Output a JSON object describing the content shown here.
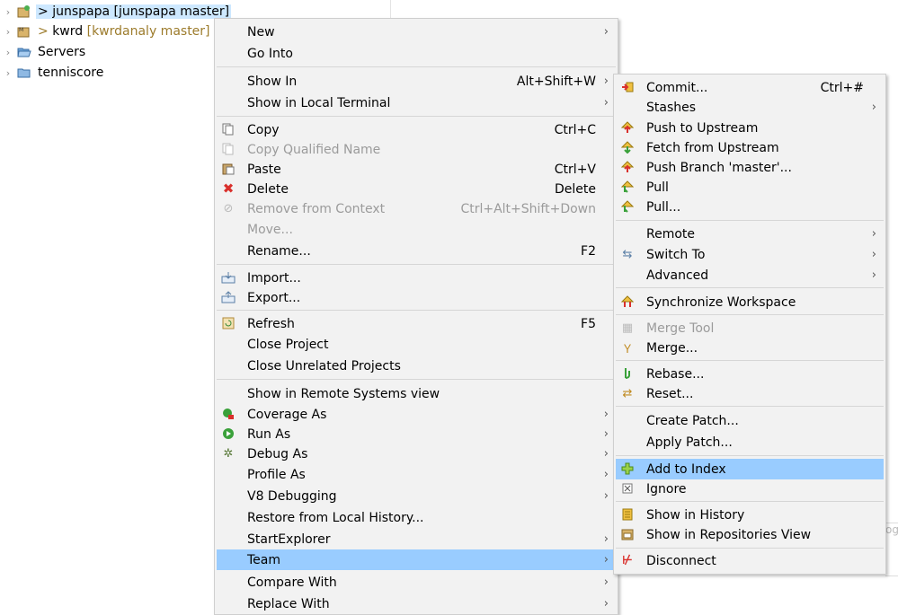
{
  "tree": {
    "items": [
      {
        "prefix": "> ",
        "name": "junspapa",
        "repo": " [junspapa master]"
      },
      {
        "prefix": "> ",
        "name": "kwrd",
        "repo": " [kwrdanaly master]"
      },
      {
        "prefix": "",
        "name": "Servers",
        "repo": ""
      },
      {
        "prefix": "",
        "name": "tenniscore",
        "repo": ""
      }
    ]
  },
  "context_menu": {
    "items": [
      {
        "label": "New",
        "accel": "",
        "submenu": true,
        "icon": ""
      },
      {
        "label": "Go Into",
        "accel": "",
        "submenu": false,
        "icon": ""
      },
      {
        "label": "Show In",
        "accel": "Alt+Shift+W",
        "submenu": true,
        "icon": ""
      },
      {
        "label": "Show in Local Terminal",
        "accel": "",
        "submenu": true,
        "icon": ""
      },
      {
        "label": "Copy",
        "accel": "Ctrl+C",
        "submenu": false,
        "icon": "copy-icon"
      },
      {
        "label": "Copy Qualified Name",
        "accel": "",
        "submenu": false,
        "icon": "copy-qualified-name-icon"
      },
      {
        "label": "Paste",
        "accel": "Ctrl+V",
        "submenu": false,
        "icon": "paste-icon"
      },
      {
        "label": "Delete",
        "accel": "Delete",
        "submenu": false,
        "icon": "delete-icon"
      },
      {
        "label": "Remove from Context",
        "accel": "Ctrl+Alt+Shift+Down",
        "submenu": false,
        "icon": "remove-from-context-icon"
      },
      {
        "label": "Move...",
        "accel": "",
        "submenu": false,
        "icon": ""
      },
      {
        "label": "Rename...",
        "accel": "F2",
        "submenu": false,
        "icon": ""
      },
      {
        "label": "Import...",
        "accel": "",
        "submenu": false,
        "icon": "import-icon"
      },
      {
        "label": "Export...",
        "accel": "",
        "submenu": false,
        "icon": "export-icon"
      },
      {
        "label": "Refresh",
        "accel": "F5",
        "submenu": false,
        "icon": "refresh-icon"
      },
      {
        "label": "Close Project",
        "accel": "",
        "submenu": false,
        "icon": ""
      },
      {
        "label": "Close Unrelated Projects",
        "accel": "",
        "submenu": false,
        "icon": ""
      },
      {
        "label": "Show in Remote Systems view",
        "accel": "",
        "submenu": false,
        "icon": ""
      },
      {
        "label": "Coverage As",
        "accel": "",
        "submenu": true,
        "icon": "coverage-icon"
      },
      {
        "label": "Run As",
        "accel": "",
        "submenu": true,
        "icon": "run-icon"
      },
      {
        "label": "Debug As",
        "accel": "",
        "submenu": true,
        "icon": "debug-icon"
      },
      {
        "label": "Profile As",
        "accel": "",
        "submenu": true,
        "icon": ""
      },
      {
        "label": "V8 Debugging",
        "accel": "",
        "submenu": true,
        "icon": ""
      },
      {
        "label": "Restore from Local History...",
        "accel": "",
        "submenu": false,
        "icon": ""
      },
      {
        "label": "StartExplorer",
        "accel": "",
        "submenu": true,
        "icon": ""
      },
      {
        "label": "Team",
        "accel": "",
        "submenu": true,
        "icon": ""
      },
      {
        "label": "Compare With",
        "accel": "",
        "submenu": true,
        "icon": ""
      },
      {
        "label": "Replace With",
        "accel": "",
        "submenu": true,
        "icon": ""
      }
    ]
  },
  "team_menu": {
    "items": [
      {
        "label": "Commit...",
        "accel": "Ctrl+#",
        "submenu": false,
        "icon": "commit-icon"
      },
      {
        "label": "Stashes",
        "accel": "",
        "submenu": true,
        "icon": ""
      },
      {
        "label": "Push to Upstream",
        "accel": "",
        "submenu": false,
        "icon": "push-icon"
      },
      {
        "label": "Fetch from Upstream",
        "accel": "",
        "submenu": false,
        "icon": "fetch-icon"
      },
      {
        "label": "Push Branch 'master'...",
        "accel": "",
        "submenu": false,
        "icon": "push-branch-icon"
      },
      {
        "label": "Pull",
        "accel": "",
        "submenu": false,
        "icon": "pull-icon"
      },
      {
        "label": "Pull...",
        "accel": "",
        "submenu": false,
        "icon": "pull-dialog-icon"
      },
      {
        "label": "Remote",
        "accel": "",
        "submenu": true,
        "icon": ""
      },
      {
        "label": "Switch To",
        "accel": "",
        "submenu": true,
        "icon": "switch-branch-icon"
      },
      {
        "label": "Advanced",
        "accel": "",
        "submenu": true,
        "icon": ""
      },
      {
        "label": "Synchronize Workspace",
        "accel": "",
        "submenu": false,
        "icon": "synchronize-icon"
      },
      {
        "label": "Merge Tool",
        "accel": "",
        "submenu": false,
        "icon": "merge-tool-icon"
      },
      {
        "label": "Merge...",
        "accel": "",
        "submenu": false,
        "icon": "merge-icon"
      },
      {
        "label": "Rebase...",
        "accel": "",
        "submenu": false,
        "icon": "rebase-icon"
      },
      {
        "label": "Reset...",
        "accel": "",
        "submenu": false,
        "icon": "reset-icon"
      },
      {
        "label": "Create Patch...",
        "accel": "",
        "submenu": false,
        "icon": ""
      },
      {
        "label": "Apply Patch...",
        "accel": "",
        "submenu": false,
        "icon": ""
      },
      {
        "label": "Add to Index",
        "accel": "",
        "submenu": false,
        "icon": "add-to-index-icon"
      },
      {
        "label": "Ignore",
        "accel": "",
        "submenu": false,
        "icon": "ignore-icon"
      },
      {
        "label": "Show in History",
        "accel": "",
        "submenu": false,
        "icon": "history-icon"
      },
      {
        "label": "Show in Repositories View",
        "accel": "",
        "submenu": false,
        "icon": "repositories-view-icon"
      },
      {
        "label": "Disconnect",
        "accel": "",
        "submenu": false,
        "icon": "disconnect-icon"
      }
    ]
  },
  "submenu_arrow": "›",
  "editor_fragment": "og"
}
